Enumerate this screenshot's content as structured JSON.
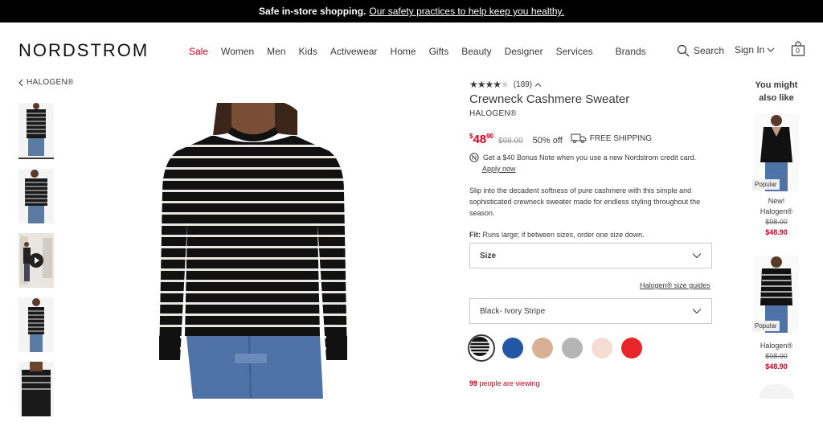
{
  "banner": {
    "bold": "Safe in-store shopping.",
    "link": "Our safety practices to help keep you healthy."
  },
  "header": {
    "logo": "NORDSTROM",
    "nav": [
      "Sale",
      "Women",
      "Men",
      "Kids",
      "Activewear",
      "Home",
      "Gifts",
      "Beauty",
      "Designer",
      "Services"
    ],
    "brands": "Brands",
    "search": "Search",
    "signin": "Sign In",
    "bag_count": "0"
  },
  "breadcrumb": {
    "label": "HALOGEN®"
  },
  "product": {
    "rating_count": "(189)",
    "title": "Crewneck Cashmere Sweater",
    "brand": "HALOGEN®",
    "price_dollars": "48",
    "price_cents": "90",
    "price_currency": "$",
    "original_price": "$98.00",
    "discount": "50% off",
    "shipping": "FREE SHIPPING",
    "bonus_note": "Get a $40 Bonus Note when you use a new Nordstrom credit card.",
    "apply_now": "Apply now",
    "description": "Slip into the decadent softness of pure cashmere with this simple and sophisticated crewneck sweater made for endless styling throughout the season.",
    "fit_label": "Fit:",
    "fit_text": "Runs large; if between sizes, order one size down.",
    "size_label": "Size",
    "size_guides": "Halogen® size guides",
    "color_selected": "Black- Ivory Stripe",
    "swatch_colors": [
      "#1c1c1c",
      "#2456a6",
      "#d8b195",
      "#b5b5b5",
      "#f5ddd3",
      "#e8262a"
    ],
    "viewing_count": "99",
    "viewing_text": " people are viewing"
  },
  "recommendations": {
    "heading": "You might also like",
    "items": [
      {
        "badge": "Popular",
        "tag": "New!",
        "brand": "Halogen®",
        "orig": "$98.00",
        "price": "$48.90"
      },
      {
        "badge": "Popular",
        "tag": "",
        "brand": "Halogen®",
        "orig": "$98.00",
        "price": "$48.90"
      }
    ]
  },
  "colors": {
    "accent_red": "#d6001c",
    "text": "#393939"
  }
}
